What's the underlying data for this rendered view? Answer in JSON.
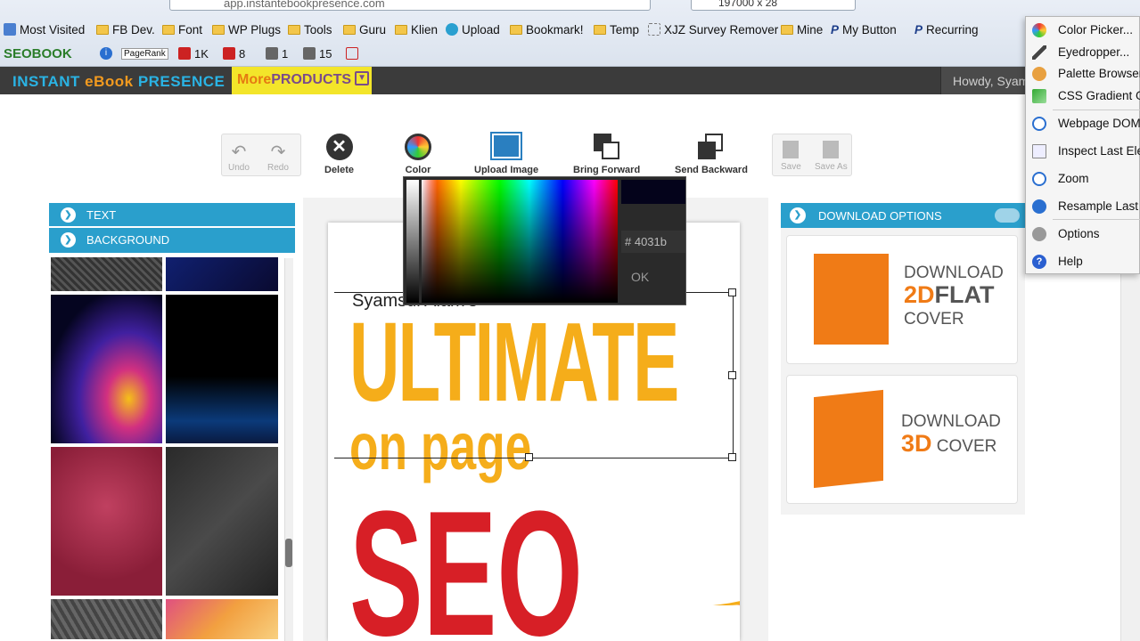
{
  "browser": {
    "url": "app.instantebookpresence.com",
    "search_value": "197000 x 28",
    "bookmarks": [
      "Most Visited",
      "FB Dev.",
      "Font",
      "WP Plugs",
      "Tools",
      "Guru",
      "Klien",
      "Upload",
      "Bookmark!",
      "Temp",
      "XJZ Survey Remover",
      "Mine",
      "My Button",
      "Recurring"
    ],
    "seo_toolbar": {
      "brand": "SEOBOOK",
      "pagerank_label": "PageRank",
      "val1": "1K",
      "val2": "8",
      "val3": "1",
      "val4": "15"
    }
  },
  "app": {
    "logo_left": "INSTANT ",
    "logo_mid": "eBook",
    "logo_right": " PRESENCE",
    "more_a": "More",
    "more_b": "PRODUCTS",
    "howdy": "Howdy, Syam"
  },
  "toolbar": {
    "undo": "Undo",
    "redo": "Redo",
    "delete": "Delete",
    "color": "Color",
    "upload": "Upload Image",
    "bring_forward": "Bring Forward",
    "send_backward": "Send Backward",
    "save": "Save",
    "save_as": "Save As"
  },
  "left_panel": {
    "text_label": "TEXT",
    "background_label": "BACKGROUND"
  },
  "cover": {
    "author": "Syamsul Alam's",
    "title1": "ULTIMATE",
    "title2": "on page",
    "title3": "SEO"
  },
  "color_picker": {
    "hex_value": "# 4031b",
    "ok": "OK",
    "swatch_color": "#04031b"
  },
  "download": {
    "header": "DOWNLOAD OPTIONS",
    "flat": {
      "line1": "DOWNLOAD",
      "big": "2D",
      "line2": "FLAT",
      "line3": "COVER"
    },
    "threed": {
      "line1": "DOWNLOAD",
      "big": "3D",
      "line3": "COVER"
    }
  },
  "ff_menu": [
    "Color Picker...",
    "Eyedropper...",
    "Palette Browser...",
    "CSS Gradient Generator",
    "Webpage DOM",
    "Inspect Last Element",
    "Zoom",
    "Resample Last L",
    "Options",
    "Help"
  ],
  "colors": {
    "accent": "#2a9fcc",
    "orange": "#f07b16",
    "cover_yellow": "#f5ad1a",
    "cover_red": "#d71f26"
  }
}
